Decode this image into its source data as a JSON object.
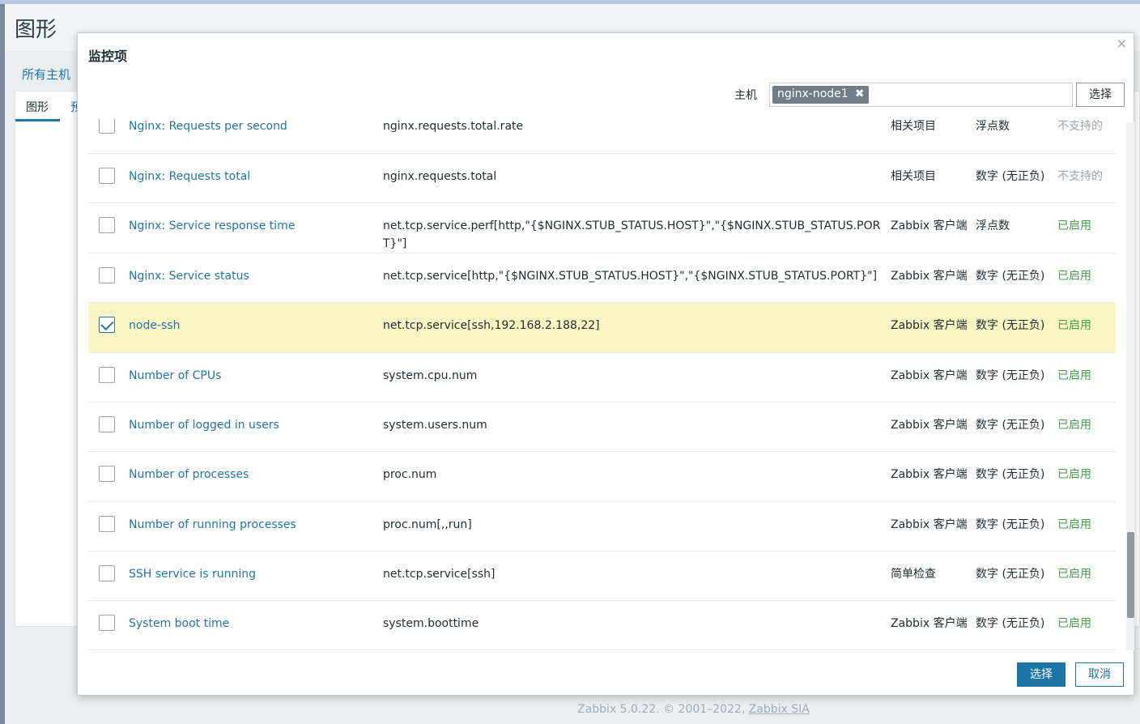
{
  "background": {
    "page_title": "图形",
    "filter_link": "所有主机",
    "tab_graphs": "图形",
    "tab_preview": "预",
    "footer_text": "Zabbix 5.0.22. © 2001–2022, ",
    "footer_link": "Zabbix SIA"
  },
  "modal": {
    "title": "监控项",
    "close_icon": "×",
    "host_label": "主机",
    "host_tag": "nginx-node1",
    "host_tag_remove": "✖",
    "host_select_button": "选择",
    "items": [
      {
        "name": "Nginx: Requests per second",
        "key": "nginx.requests.total.rate",
        "type": "相关项目",
        "value_type": "浮点数",
        "status": "不支持的",
        "status_kind": "off",
        "checked": false
      },
      {
        "name": "Nginx: Requests total",
        "key": "nginx.requests.total",
        "type": "相关项目",
        "value_type": "数字 (无正负)",
        "status": "不支持的",
        "status_kind": "off",
        "checked": false
      },
      {
        "name": "Nginx: Service response time",
        "key": "net.tcp.service.perf[http,\"{$NGINX.STUB_STATUS.HOST}\",\"{$NGINX.STUB_STATUS.PORT}\"]",
        "type": "Zabbix 客户端",
        "value_type": "浮点数",
        "status": "已启用",
        "status_kind": "on",
        "checked": false
      },
      {
        "name": "Nginx: Service status",
        "key": "net.tcp.service[http,\"{$NGINX.STUB_STATUS.HOST}\",\"{$NGINX.STUB_STATUS.PORT}\"]",
        "type": "Zabbix 客户端",
        "value_type": "数字 (无正负)",
        "status": "已启用",
        "status_kind": "on",
        "checked": false
      },
      {
        "name": "node-ssh",
        "key": "net.tcp.service[ssh,192.168.2.188,22]",
        "type": "Zabbix 客户端",
        "value_type": "数字 (无正负)",
        "status": "已启用",
        "status_kind": "on",
        "checked": true
      },
      {
        "name": "Number of CPUs",
        "key": "system.cpu.num",
        "type": "Zabbix 客户端",
        "value_type": "数字 (无正负)",
        "status": "已启用",
        "status_kind": "on",
        "checked": false
      },
      {
        "name": "Number of logged in users",
        "key": "system.users.num",
        "type": "Zabbix 客户端",
        "value_type": "数字 (无正负)",
        "status": "已启用",
        "status_kind": "on",
        "checked": false
      },
      {
        "name": "Number of processes",
        "key": "proc.num",
        "type": "Zabbix 客户端",
        "value_type": "数字 (无正负)",
        "status": "已启用",
        "status_kind": "on",
        "checked": false
      },
      {
        "name": "Number of running processes",
        "key": "proc.num[,,run]",
        "type": "Zabbix 客户端",
        "value_type": "数字 (无正负)",
        "status": "已启用",
        "status_kind": "on",
        "checked": false
      },
      {
        "name": "SSH service is running",
        "key": "net.tcp.service[ssh]",
        "type": "简单检查",
        "value_type": "数字 (无正负)",
        "status": "已启用",
        "status_kind": "on",
        "checked": false
      },
      {
        "name": "System boot time",
        "key": "system.boottime",
        "type": "Zabbix 客户端",
        "value_type": "数字 (无正负)",
        "status": "已启用",
        "status_kind": "on",
        "checked": false
      }
    ],
    "select_button": "选择",
    "cancel_button": "取消"
  },
  "colors": {
    "link": "#1f75a8",
    "enabled": "#429e47",
    "unsupported": "#9aa4ab",
    "selected_row": "#fbf5c3"
  }
}
